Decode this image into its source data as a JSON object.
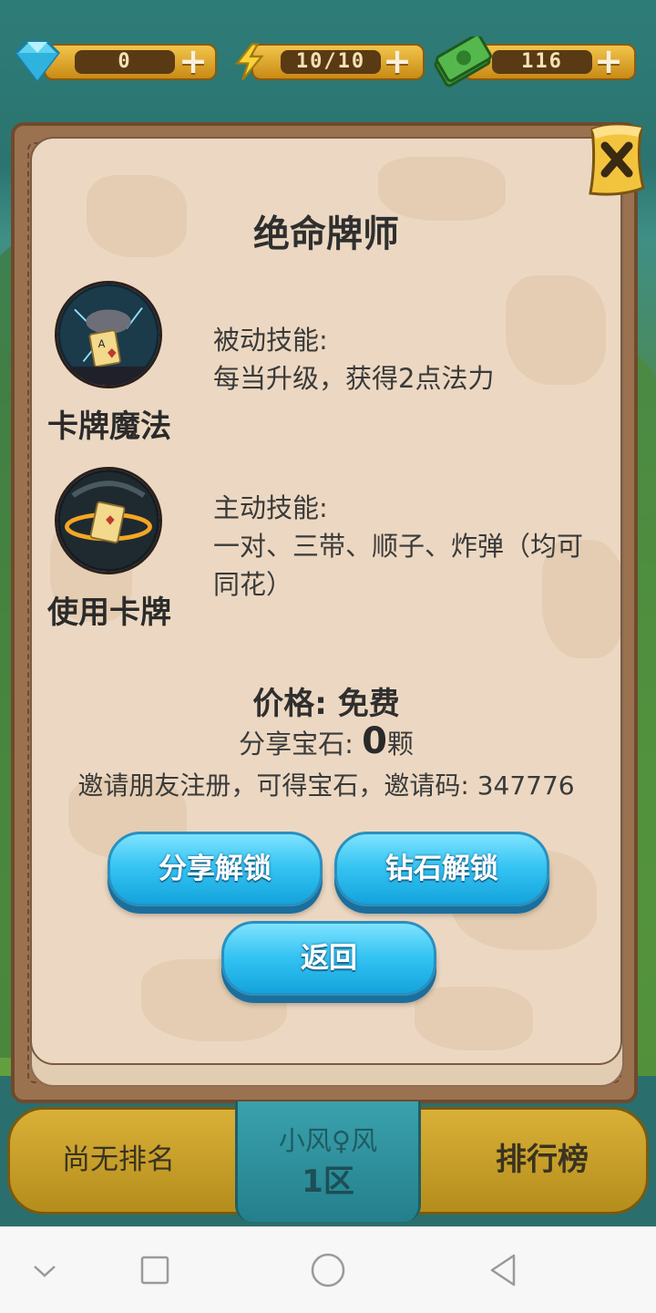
{
  "topbar": {
    "gems": "0",
    "energy": "10/10",
    "cash": "116"
  },
  "dialog": {
    "title": "绝命牌师",
    "skills": [
      {
        "name": "卡牌魔法",
        "type_label": "被动技能:",
        "desc": "每当升级，获得2点法力"
      },
      {
        "name": "使用卡牌",
        "type_label": "主动技能:",
        "desc_line1": "一对、三带、顺子、炸弹（均可",
        "desc_line2": "同花）"
      }
    ],
    "price_label": "价格:",
    "price_value": "免费",
    "share_gem_label": "分享宝石:",
    "share_gem_count": "0",
    "share_gem_unit": "颗",
    "invite_text": "邀请朋友注册，可得宝石，邀请码: 347776",
    "buttons": {
      "share_unlock": "分享解锁",
      "diamond_unlock": "钻石解锁",
      "back": "返回"
    }
  },
  "rank": {
    "left": "尚无排名",
    "player_name": "小风♀风",
    "zone": "1区",
    "leaderboard": "排行榜"
  },
  "icons": {
    "gem": "diamond-icon",
    "energy": "lightning-icon",
    "cash": "money-icon",
    "close": "close-icon",
    "nav": [
      "nav-down-icon",
      "recent-apps-icon",
      "home-icon",
      "back-icon"
    ]
  },
  "colors": {
    "button_blue": "#34c3f2",
    "panel_paper": "#ecd8c2",
    "frame_brown": "#9b7250",
    "gold": "#d9b037"
  }
}
